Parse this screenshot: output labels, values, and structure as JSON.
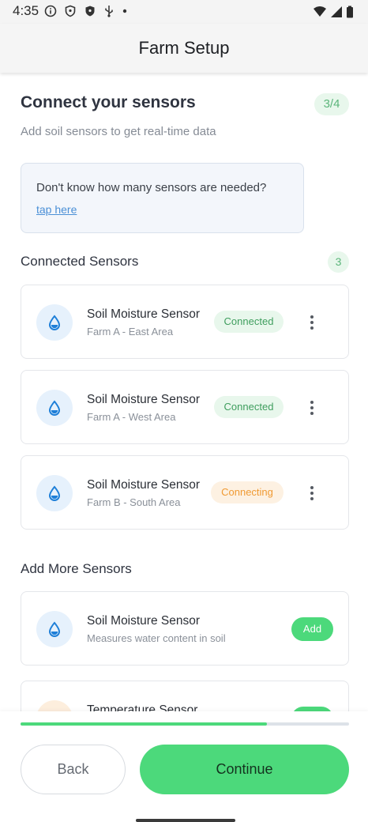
{
  "status_bar": {
    "time": "4:35",
    "icons": [
      "info-circle-icon",
      "shield-outline-icon",
      "shield-filled-icon",
      "usb-icon",
      "dot-icon"
    ],
    "right_icons": [
      "wifi-icon",
      "signal-icon",
      "battery-icon"
    ]
  },
  "app_bar": {
    "title": "Farm Setup"
  },
  "header": {
    "title": "Connect your sensors",
    "step": "3/4",
    "subtitle": "Add soil sensors to get real-time data"
  },
  "info_box": {
    "text": "Don't know how many sensors are needed?",
    "link": "tap here"
  },
  "connected_section": {
    "title": "Connected Sensors",
    "count": "3",
    "sensors": [
      {
        "name": "Soil Moisture Sensor",
        "location": "Farm A - East Area",
        "status": "Connected",
        "icon": "water-drop-icon"
      },
      {
        "name": "Soil Moisture Sensor",
        "location": "Farm A - West Area",
        "status": "Connected",
        "icon": "water-drop-icon"
      },
      {
        "name": "Soil Moisture Sensor",
        "location": "Farm B - South Area",
        "status": "Connecting",
        "icon": "water-drop-icon"
      }
    ]
  },
  "add_section": {
    "title": "Add More Sensors",
    "sensors": [
      {
        "name": "Soil Moisture Sensor",
        "description": "Measures water content in soil",
        "button": "Add",
        "icon": "water-drop-icon"
      },
      {
        "name": "Temperature Sensor",
        "button": "Add",
        "icon": "thermometer-icon"
      }
    ]
  },
  "footer": {
    "progress_fraction": 0.75,
    "back_label": "Back",
    "continue_label": "Continue"
  },
  "colors": {
    "accent": "#4cd97b",
    "connected_text": "#3f9e5e",
    "connecting_text": "#f09a33",
    "link": "#4a8fd6"
  }
}
